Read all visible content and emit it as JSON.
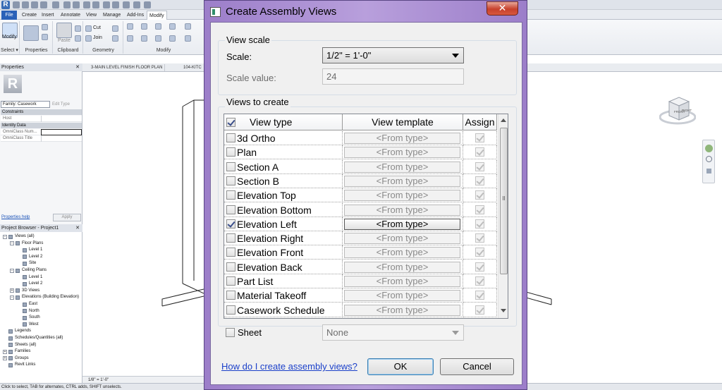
{
  "revit": {
    "ribbon_tabs": [
      "File",
      "Create",
      "Insert",
      "Annotate",
      "View",
      "Manage",
      "Add-Ins",
      "Modify"
    ],
    "ribbon_panels": {
      "modify_label": "Modify",
      "select_label": "Select ▾",
      "properties_label": "Properties",
      "clipboard_label": "Clipboard",
      "geometry_label": "Geometry",
      "modify_panel_label": "Modify",
      "paste_label": "Paste",
      "cut_label": "Cut",
      "join_label": "Join"
    },
    "properties": {
      "title": "Properties",
      "family": "Family: Casework",
      "edit_type": "Edit Type",
      "constraints": "Constraints",
      "host": "Host",
      "identity_data": "Identity Data",
      "omniclass_num": "OmniClass Num...",
      "omniclass_title": "OmniClass Title",
      "help_link": "Properties help",
      "apply": "Apply"
    },
    "project_browser": {
      "title": "Project Browser - Project1",
      "tree": [
        {
          "label": "Views (all)",
          "level": 0,
          "toggle": "−"
        },
        {
          "label": "Floor Plans",
          "level": 1,
          "toggle": "−"
        },
        {
          "label": "Level 1",
          "level": 2,
          "toggle": ""
        },
        {
          "label": "Level 2",
          "level": 2,
          "toggle": ""
        },
        {
          "label": "Site",
          "level": 2,
          "toggle": ""
        },
        {
          "label": "Ceiling Plans",
          "level": 1,
          "toggle": "−"
        },
        {
          "label": "Level 1",
          "level": 2,
          "toggle": ""
        },
        {
          "label": "Level 2",
          "level": 2,
          "toggle": ""
        },
        {
          "label": "3D Views",
          "level": 1,
          "toggle": "+"
        },
        {
          "label": "Elevations (Building Elevation)",
          "level": 1,
          "toggle": "−"
        },
        {
          "label": "East",
          "level": 2,
          "toggle": ""
        },
        {
          "label": "North",
          "level": 2,
          "toggle": ""
        },
        {
          "label": "South",
          "level": 2,
          "toggle": ""
        },
        {
          "label": "West",
          "level": 2,
          "toggle": ""
        },
        {
          "label": "Legends",
          "level": 0,
          "toggle": ""
        },
        {
          "label": "Schedules/Quantities (all)",
          "level": 0,
          "toggle": ""
        },
        {
          "label": "Sheets (all)",
          "level": 0,
          "toggle": ""
        },
        {
          "label": "Families",
          "level": 0,
          "toggle": "+"
        },
        {
          "label": "Groups",
          "level": 0,
          "toggle": "+"
        },
        {
          "label": "Revit Links",
          "level": 0,
          "toggle": ""
        }
      ]
    },
    "view_tabs": [
      "3-MAIN LEVEL FINISH FLOOR PLAN",
      "104-KITC"
    ],
    "view_scale": "1/8\" = 1'-0\"",
    "status": "Click to select, TAB for alternates, CTRL adds, SHIFT unselects.",
    "viewcube": {
      "front": "FRONT",
      "right": "RIGHT"
    }
  },
  "dialog": {
    "title": "Create Assembly Views",
    "close_glyph": "✕",
    "view_scale_group": "View scale",
    "scale_label": "Scale:",
    "scale_value": "1/2\" = 1'-0\"",
    "scale_value_label": "Scale value:",
    "scale_value_number": "24",
    "views_group": "Views to create",
    "columns": {
      "view_type": "View type",
      "view_template": "View template",
      "assign": "Assign"
    },
    "rows": [
      {
        "name": "3d Ortho",
        "selected": false,
        "template": "<From type>",
        "assign": true
      },
      {
        "name": "Plan",
        "selected": false,
        "template": "<From type>",
        "assign": true
      },
      {
        "name": "Section A",
        "selected": false,
        "template": "<From type>",
        "assign": true
      },
      {
        "name": "Section B",
        "selected": false,
        "template": "<From type>",
        "assign": true
      },
      {
        "name": "Elevation Top",
        "selected": false,
        "template": "<From type>",
        "assign": true
      },
      {
        "name": "Elevation Bottom",
        "selected": false,
        "template": "<From type>",
        "assign": true
      },
      {
        "name": "Elevation Left",
        "selected": true,
        "template": "<From type>",
        "assign": true
      },
      {
        "name": "Elevation Right",
        "selected": false,
        "template": "<From type>",
        "assign": true
      },
      {
        "name": "Elevation Front",
        "selected": false,
        "template": "<From type>",
        "assign": true
      },
      {
        "name": "Elevation Back",
        "selected": false,
        "template": "<From type>",
        "assign": true
      },
      {
        "name": "Part List",
        "selected": false,
        "template": "<From type>",
        "assign": true
      },
      {
        "name": "Material Takeoff",
        "selected": false,
        "template": "<From type>",
        "assign": true
      },
      {
        "name": "Casework Schedule",
        "selected": false,
        "template": "<From type>",
        "assign": true
      }
    ],
    "select_all_checked": true,
    "sheet_label": "Sheet",
    "sheet_checked": false,
    "sheet_value": "None",
    "help_link": "How do I create assembly views?",
    "ok": "OK",
    "cancel": "Cancel"
  }
}
